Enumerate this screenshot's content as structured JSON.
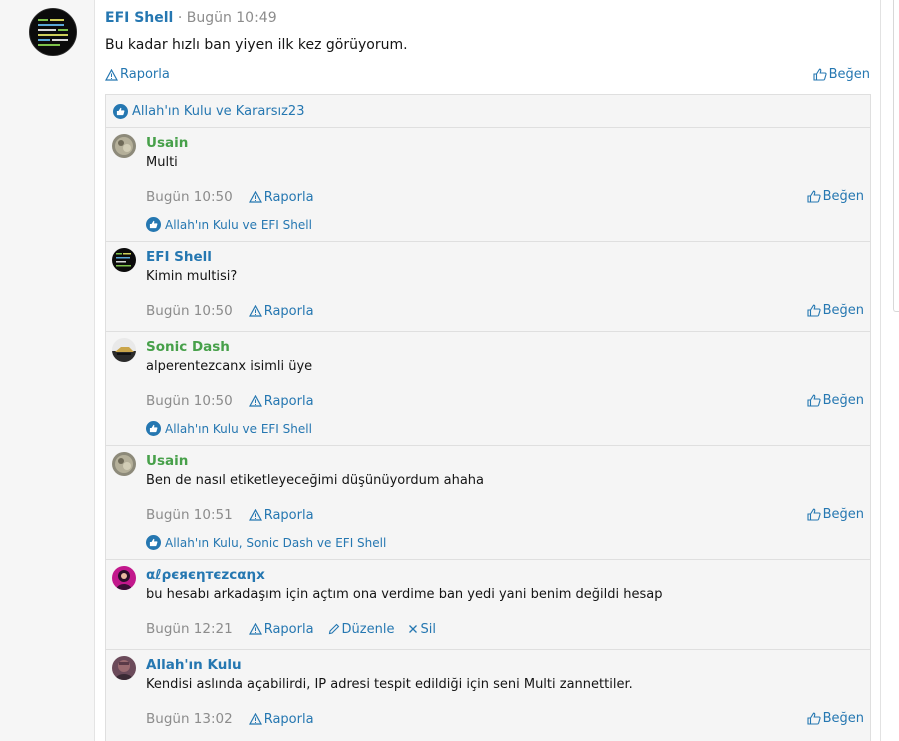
{
  "post": {
    "author": "EFI Shell",
    "separator": "·",
    "time": "Bugün 10:49",
    "text": "Bu kadar hızlı ban yiyen ilk kez görüyorum.",
    "report_label": "Raporla",
    "like_label": "Beğen",
    "likes_text": "Allah'ın Kulu ve Kararsız23"
  },
  "comments": [
    {
      "author": "Usain",
      "author_color": "#47a04a",
      "text": "Multi",
      "time": "Bugün 10:50",
      "report_label": "Raporla",
      "like_label": "Beğen",
      "likes_text": "Allah'ın Kulu ve EFI Shell"
    },
    {
      "author": "EFI Shell",
      "author_color": "#2577b1",
      "text": "Kimin multisi?",
      "time": "Bugün 10:50",
      "report_label": "Raporla",
      "like_label": "Beğen"
    },
    {
      "author": "Sonic Dash",
      "author_color": "#47a04a",
      "text": "alperentezcanx isimli üye",
      "time": "Bugün 10:50",
      "report_label": "Raporla",
      "like_label": "Beğen",
      "likes_text": "Allah'ın Kulu ve EFI Shell"
    },
    {
      "author": "Usain",
      "author_color": "#47a04a",
      "text": "Ben de nasıl etiketleyeceğimi düşünüyordum ahaha",
      "time": "Bugün 10:51",
      "report_label": "Raporla",
      "like_label": "Beğen",
      "likes_text": "Allah'ın Kulu, Sonic Dash ve EFI Shell"
    },
    {
      "author": "αℓρєяєηтєzcαηx",
      "author_color": "#2577b1",
      "text": "bu hesabı arkadaşım için açtım ona verdime ban yedi yani benim değildi hesap",
      "time": "Bugün 12:21",
      "report_label": "Raporla",
      "edit_label": "Düzenle",
      "delete_label": "Sil"
    },
    {
      "author": "Allah'ın Kulu",
      "author_color": "#2577b1",
      "text": "Kendisi aslında açabilirdi, IP adresi tespit edildiği için seni Multi zannettiler.",
      "time": "Bugün 13:02",
      "report_label": "Raporla",
      "like_label": "Beğen"
    }
  ],
  "icons": {
    "report": "warning-triangle-icon",
    "like": "thumbs-up-icon",
    "edit": "pencil-icon",
    "delete": "x-icon"
  },
  "colors": {
    "link": "#2577b1",
    "green_group": "#47a04a",
    "meta": "#8c8c8c",
    "comment_bg": "#f5f5f5"
  }
}
